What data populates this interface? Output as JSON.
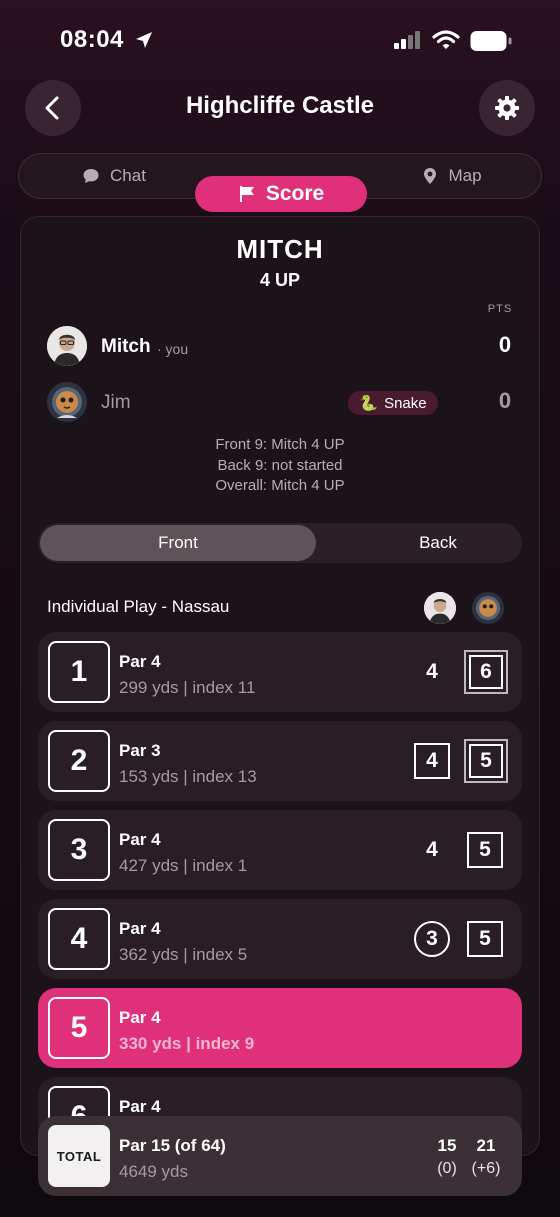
{
  "status_bar": {
    "time": "08:04"
  },
  "header": {
    "title": "Highcliffe Castle"
  },
  "tabs": [
    {
      "label": "Chat",
      "icon": "chat-bubble-icon"
    },
    {
      "label": "Score",
      "icon": "flag-icon",
      "active": true
    },
    {
      "label": "Map",
      "icon": "map-pin-icon"
    }
  ],
  "match": {
    "leader": "MITCH",
    "status": "4 UP",
    "pts_label": "PTS",
    "players": [
      {
        "name": "Mitch",
        "suffix": "· you",
        "points": "0"
      },
      {
        "name": "Jim",
        "badge": "Snake",
        "badge_emoji": "🐍",
        "points": "0"
      }
    ],
    "summary": [
      "Front 9: Mitch 4 UP",
      "Back 9: not started",
      "Overall: Mitch 4 UP"
    ]
  },
  "nine_toggle": {
    "front": "Front",
    "back": "Back",
    "selected": "Front"
  },
  "mode_label": "Individual Play - Nassau",
  "holes": [
    {
      "num": "1",
      "par": "Par 4",
      "info": "299 yds | index 11",
      "mitch": "4",
      "jim": "6"
    },
    {
      "num": "2",
      "par": "Par 3",
      "info": "153 yds | index 13",
      "mitch": "4",
      "jim": "5"
    },
    {
      "num": "3",
      "par": "Par 4",
      "info": "427 yds | index 1",
      "mitch": "4",
      "jim": "5"
    },
    {
      "num": "4",
      "par": "Par 4",
      "info": "362 yds | index 5",
      "mitch": "3",
      "jim": "5"
    },
    {
      "num": "5",
      "par": "Par 4",
      "info": "330 yds | index 9",
      "active": true
    },
    {
      "num": "6",
      "par": "Par 4"
    }
  ],
  "total": {
    "label": "TOTAL",
    "par": "Par 15 (of 64)",
    "yds": "4649 yds",
    "mitch_score": "15",
    "mitch_diff": "(0)",
    "jim_score": "21",
    "jim_diff": "(+6)"
  },
  "colors": {
    "accent": "#e0307a",
    "background": "#140b12",
    "row": "#2a1e26"
  }
}
